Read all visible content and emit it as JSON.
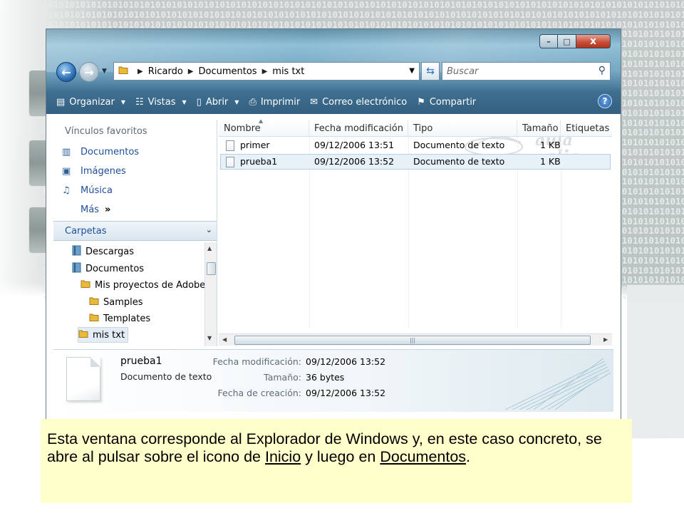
{
  "window": {
    "controls": {
      "minimize": "–",
      "maximize": "□",
      "close": "x"
    }
  },
  "navbar": {
    "breadcrumb": [
      "Ricardo",
      "Documentos",
      "mis txt"
    ],
    "search_placeholder": "Buscar"
  },
  "commandbar": {
    "items": [
      {
        "label": "Organizar",
        "icon": "organize-icon",
        "dropdown": true
      },
      {
        "label": "Vistas",
        "icon": "views-icon",
        "dropdown": true
      },
      {
        "label": "Abrir",
        "icon": "open-icon",
        "dropdown": true
      },
      {
        "label": "Imprimir",
        "icon": "printer-icon",
        "dropdown": false
      },
      {
        "label": "Correo electrónico",
        "icon": "email-icon",
        "dropdown": false
      },
      {
        "label": "Compartir",
        "icon": "share-icon",
        "dropdown": false
      }
    ],
    "help_label": "?"
  },
  "navpane": {
    "favorites_heading": "Vínculos favoritos",
    "favorites": [
      {
        "label": "Documentos",
        "icon": "documents-icon"
      },
      {
        "label": "Imágenes",
        "icon": "pictures-icon"
      },
      {
        "label": "Música",
        "icon": "music-icon"
      }
    ],
    "more_label": "Más",
    "more_glyph": "»",
    "folders_heading": "Carpetas",
    "tree": [
      {
        "label": "Descargas",
        "icon": "downloads-icon"
      },
      {
        "label": "Documentos",
        "icon": "documents-icon"
      },
      {
        "label": "Mis proyectos de Adobe",
        "icon": "folder-icon"
      },
      {
        "label": "Samples",
        "icon": "folder-icon"
      },
      {
        "label": "Templates",
        "icon": "folder-icon"
      },
      {
        "label": "mis txt",
        "icon": "folder-icon",
        "selected": true
      }
    ]
  },
  "filelist": {
    "columns": [
      "Nombre",
      "Fecha modificación",
      "Tipo",
      "Tamaño",
      "Etiquetas"
    ],
    "rows": [
      {
        "name": "primer",
        "modified": "09/12/2006 13:51",
        "type": "Documento de texto",
        "size": "1 KB",
        "selected": false
      },
      {
        "name": "prueba1",
        "modified": "09/12/2006 13:52",
        "type": "Documento de texto",
        "size": "1 KB",
        "selected": true
      }
    ]
  },
  "details": {
    "filename": "prueba1",
    "filetype": "Documento de texto",
    "fields": [
      {
        "label": "Fecha modificación:",
        "value": "09/12/2006 13:52"
      },
      {
        "label": "Tamaño:",
        "value": "36 bytes"
      },
      {
        "label": "Fecha de creación:",
        "value": "09/12/2006 13:52"
      }
    ]
  },
  "caption": {
    "part1": "Esta ventana corresponde al Explorador de Windows y, en este caso concreto, se abre al pulsar sobre el icono de ",
    "link1": "Inicio",
    "part2": " y luego en ",
    "link2": "Documentos",
    "part3": "."
  },
  "colors": {
    "aero_glass": "#5f8fa8",
    "link_blue": "#1e4f9c",
    "caption_bg": "#ffffcc",
    "selection": "#e9f1f8"
  }
}
